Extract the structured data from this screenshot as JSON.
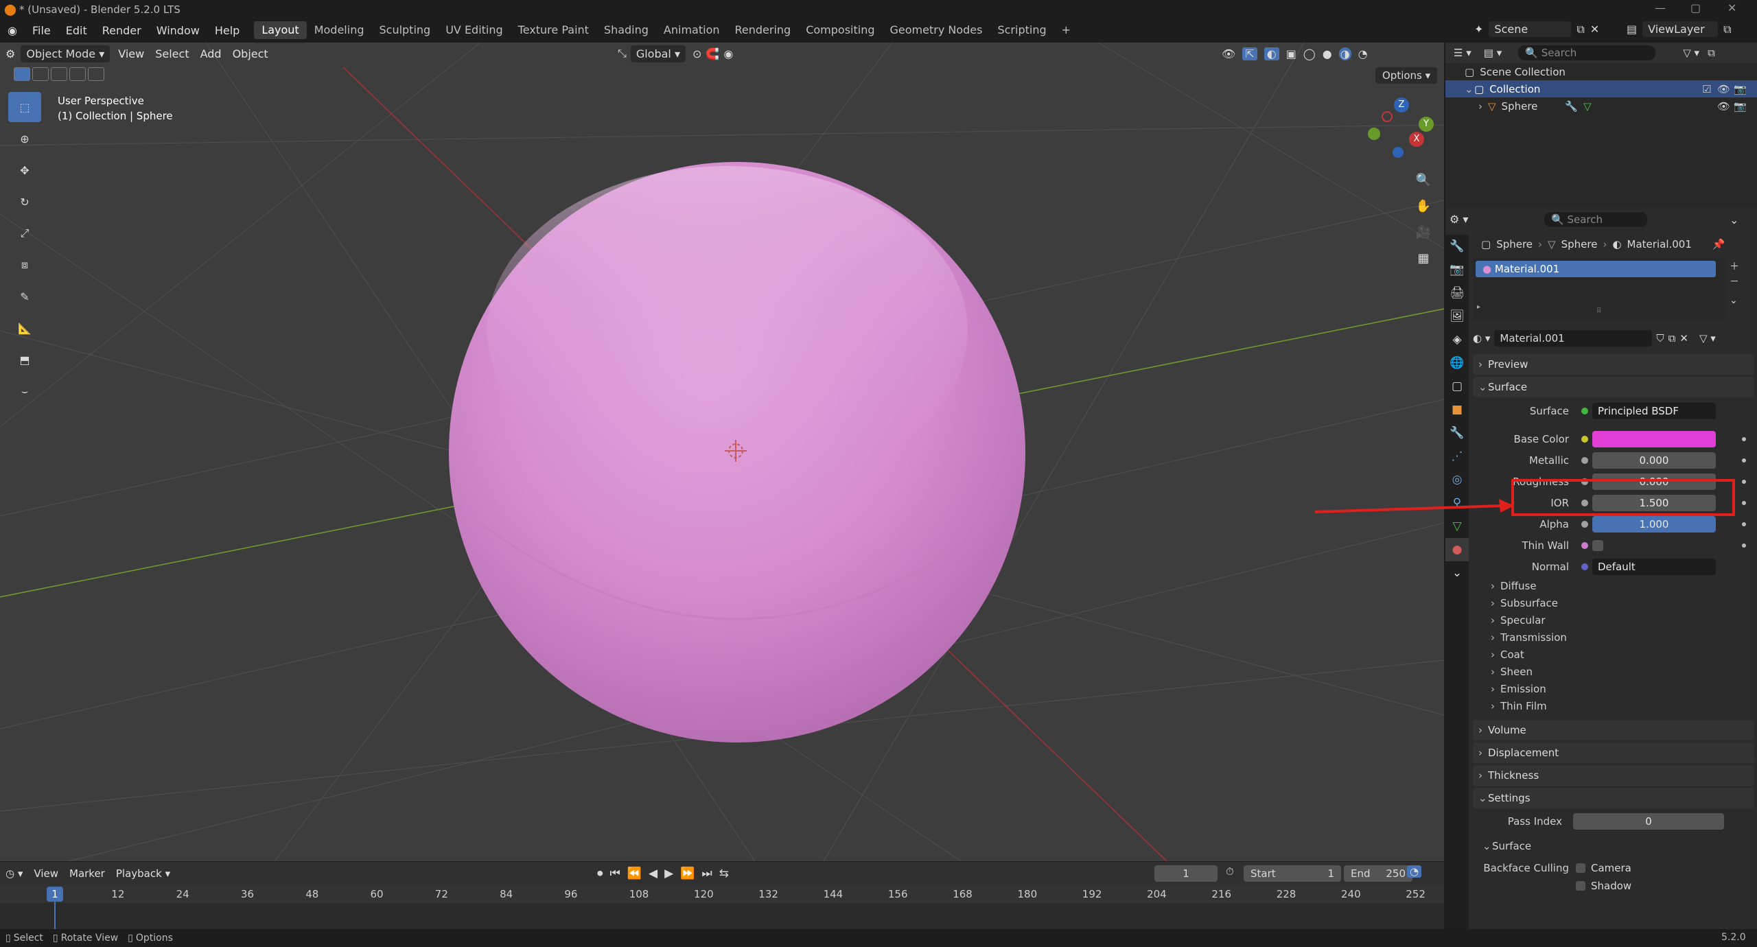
{
  "window": {
    "title": "* (Unsaved) - Blender 5.2.0 LTS"
  },
  "menu": {
    "items": [
      "File",
      "Edit",
      "Render",
      "Window",
      "Help"
    ]
  },
  "workspaces": [
    "Layout",
    "Modeling",
    "Sculpting",
    "UV Editing",
    "Texture Paint",
    "Shading",
    "Animation",
    "Rendering",
    "Compositing",
    "Geometry Nodes",
    "Scripting"
  ],
  "workspace_add": "+",
  "scene": {
    "label": "Scene",
    "viewlayer": "ViewLayer"
  },
  "viewport": {
    "mode": "Object Mode",
    "menus": [
      "View",
      "Select",
      "Add",
      "Object"
    ],
    "orientation": "Global",
    "options": "Options",
    "info_line1": "User Perspective",
    "info_line2": "(1) Collection | Sphere",
    "axes": {
      "x": "X",
      "y": "Y",
      "z": "Z"
    },
    "sphere_color": "#d98fd3",
    "background": "#3d3d3d"
  },
  "outliner": {
    "search_placeholder": "Search",
    "scene_collection": "Scene Collection",
    "collection": "Collection",
    "object": "Sphere"
  },
  "properties": {
    "search_placeholder": "Search",
    "breadcrumb": [
      "Sphere",
      "Sphere",
      "Material.001"
    ],
    "slot": "Material.001",
    "material_name": "Material.001",
    "panels": {
      "preview": "Preview",
      "surface": "Surface",
      "volume": "Volume",
      "displacement": "Displacement",
      "thickness": "Thickness",
      "settings": "Settings"
    },
    "surface_shader": {
      "label": "Surface",
      "value": "Principled BSDF"
    },
    "fields": [
      {
        "label": "Base Color",
        "value": "",
        "kind": "color",
        "color": "#e23fd6"
      },
      {
        "label": "Metallic",
        "value": "0.000",
        "kind": "num"
      },
      {
        "label": "Roughness",
        "value": "0.000",
        "kind": "num"
      },
      {
        "label": "IOR",
        "value": "1.500",
        "kind": "num"
      },
      {
        "label": "Alpha",
        "value": "1.000",
        "kind": "full"
      },
      {
        "label": "Thin Wall",
        "value": "",
        "kind": "check"
      },
      {
        "label": "Normal",
        "value": "Default",
        "kind": "dark"
      }
    ],
    "subpanels": [
      "Diffuse",
      "Subsurface",
      "Specular",
      "Transmission",
      "Coat",
      "Sheen",
      "Emission",
      "Thin Film"
    ],
    "settings": {
      "pass_index_label": "Pass Index",
      "pass_index": "0",
      "surface_sub": "Surface",
      "backface_label": "Backface Culling",
      "camera": "Camera",
      "shadow": "Shadow"
    },
    "highlight_color": "#e0201c"
  },
  "timeline": {
    "menus": [
      "View",
      "Marker",
      "Playback"
    ],
    "current_frame": "1",
    "start_label": "Start",
    "start": "1",
    "end_label": "End",
    "end": "250",
    "ticks": [
      "12",
      "24",
      "36",
      "48",
      "60",
      "72",
      "84",
      "96",
      "108",
      "120",
      "132",
      "144",
      "156",
      "168",
      "180",
      "192",
      "204",
      "216",
      "228",
      "240",
      "252"
    ],
    "playhead": "1"
  },
  "status": {
    "select": "Select",
    "rotate": "Rotate View",
    "options": "Options",
    "version": "5.2.0"
  }
}
